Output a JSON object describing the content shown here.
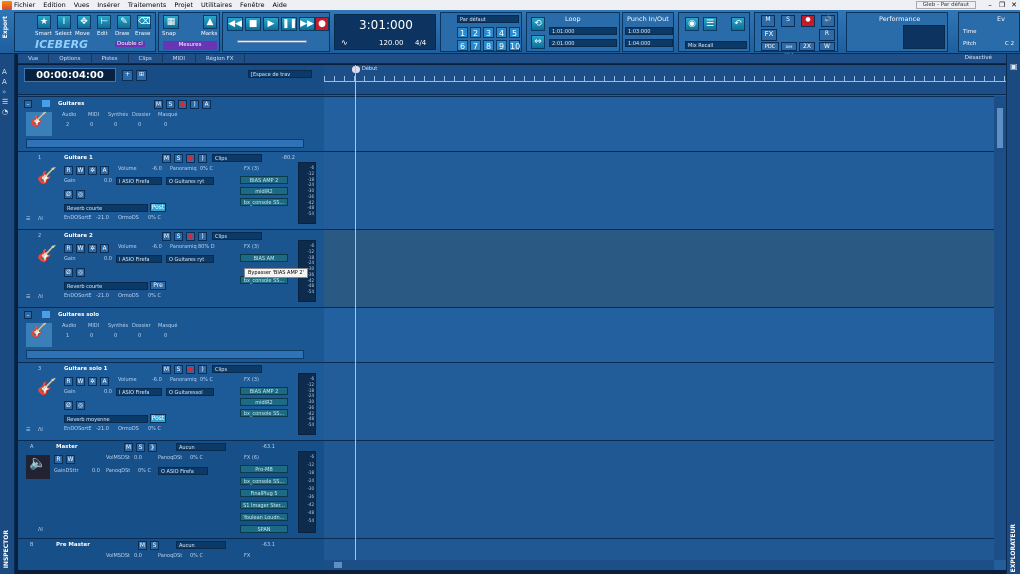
{
  "menubar": {
    "items": [
      "Fichier",
      "Edition",
      "Vues",
      "Insérer",
      "Traitements",
      "Projet",
      "Utilitaires",
      "Fenêtre",
      "Aide"
    ],
    "workspace": "Gleb - Par défaut"
  },
  "controlbar": {
    "export_label": "Export",
    "tools": [
      {
        "label": "Smart"
      },
      {
        "label": "Select"
      },
      {
        "label": "Move"
      },
      {
        "label": "Edit"
      },
      {
        "label": "Draw"
      },
      {
        "label": "Erase"
      }
    ],
    "tool_mode": "Double cl",
    "logo": "ICEBERG",
    "snap_label": "Snap",
    "marks_label": "Marks",
    "measures_label": "Mesures",
    "time_display": "3:01:000",
    "tempo": "120.00",
    "meter": "4/4",
    "preset": "Par défaut",
    "numbers_top": [
      "1",
      "2",
      "3",
      "4",
      "5"
    ],
    "numbers_bottom": [
      "6",
      "7",
      "8",
      "9",
      "10"
    ],
    "loop_label": "Loop",
    "loop_start": "1:01:000",
    "loop_end": "2:01:000",
    "punch_label": "Punch In/Out",
    "punch_start": "1:03:000",
    "punch_end": "1:04:000",
    "mix_recall": "Mix Recall",
    "mix_buttons": [
      "M",
      "S",
      "R"
    ],
    "fx_label": "FX",
    "pdc_label": "PDC",
    "dim_solo": "DIM SOLO",
    "speed": "2X",
    "w_label": "W",
    "performance_label": "Performance",
    "ev_label": "Ev",
    "time_label": "Time",
    "pitch_label": "Pitch",
    "pitch_value": "C 2"
  },
  "tabs": [
    "Vue",
    "Options",
    "Pistes",
    "Clips",
    "MIDI",
    "Région FX"
  ],
  "track_header": {
    "time": "00:00:04:00",
    "workspace_dropdown": "[Espace de trav",
    "desactive": "Désactivé"
  },
  "side": {
    "left": "INSPECTOR",
    "right": "EXPLORATEUR"
  },
  "folders": [
    {
      "name": "Guitares",
      "cols": [
        "Audio",
        "MIDI",
        "Synthés",
        "Dossier",
        "Masqué"
      ],
      "counts": [
        "2",
        "0",
        "0",
        "0",
        "0"
      ]
    },
    {
      "name": "Guitares solo",
      "cols": [
        "Audio",
        "MIDI",
        "Synthés",
        "Dossier",
        "Masqué"
      ],
      "counts": [
        "1",
        "0",
        "0",
        "0",
        "0"
      ]
    }
  ],
  "tracks": [
    {
      "num": "1",
      "name": "Guitare 1",
      "clips": "Clips",
      "db": "-80.2",
      "volume": "Volume",
      "vol_val": "-6.0",
      "pan": "Panoramiq",
      "pan_val": "0% C",
      "gain": "Gain",
      "gain_val": "0.0",
      "input": "I ASIO Firefa",
      "output": "O Guitares ryt",
      "send": "Reverb courte",
      "post": "Post",
      "send_lvl": "EnDOSortE",
      "send_val": "-21.0",
      "send_pan": "OrmoDS",
      "send_pan_val": "0% C",
      "fx_count": "FX (3)",
      "fx": [
        "BIAS AMP 2",
        "midiR2",
        "bx_console SS..."
      ]
    },
    {
      "num": "2",
      "name": "Guitare 2",
      "clips": "Clips",
      "db": "",
      "volume": "Volume",
      "vol_val": "-6.0",
      "pan": "Panoramiq",
      "pan_val": "80% D",
      "gain": "Gain",
      "gain_val": "0.0",
      "input": "I ASIO Firefa",
      "output": "O Guitares ryt",
      "send": "Reverb courte",
      "post": "Pre",
      "send_lvl": "EnDOSortE",
      "send_val": "-21.0",
      "send_pan": "OrmoDS",
      "send_pan_val": "0% C",
      "fx_count": "FX (3)",
      "fx": [
        "BIAS AM",
        "",
        "bx_console SS..."
      ]
    },
    {
      "num": "3",
      "name": "Guitare solo 1",
      "clips": "Clips",
      "db": "",
      "volume": "Volume",
      "vol_val": "-6.0",
      "pan": "Panoramiq",
      "pan_val": "0% C",
      "gain": "Gain",
      "gain_val": "0.0",
      "input": "I ASIO Firefa",
      "output": "O Guitaressol",
      "send": "Reverb moyenne",
      "post": "Post",
      "send_lvl": "EnDOSortE",
      "send_val": "-21.0",
      "send_pan": "OrmoDS",
      "send_pan_val": "0% C",
      "fx_count": "FX (3)",
      "fx": [
        "BIAS AMP 2",
        "midiR2",
        "bx_console SS..."
      ]
    }
  ],
  "master": {
    "label": "A",
    "name": "Master",
    "route": "Aucun",
    "db": "-63.1",
    "vol": "VolMSDSt",
    "vol_val": "0.0",
    "pan": "PanoqDSt",
    "pan_val": "0% C",
    "gain": "GainDSttr",
    "gain_val": "0.0",
    "pan2": "PanoqDSt",
    "pan2_val": "0% C",
    "input": "O ASIO Firefa",
    "fx_count": "FX (6)",
    "fx": [
      "Pro-MB",
      "bx_console SS...",
      "FinalPlug 5",
      "S1 Imager Ster...",
      "Youlean Loudn...",
      "SPAN"
    ]
  },
  "premaster": {
    "num": "B",
    "name": "Pre Master",
    "route": "Aucun",
    "db": "-63.1",
    "vol": "VolMSDSt",
    "vol_val": "0.0",
    "pan": "PanoqDSt",
    "pan_val": "0% C",
    "fx_count": "FX"
  },
  "tooltip": "Bypasser 'BIAS AMP 2'",
  "ruler_label": "Début",
  "meter_ticks": [
    "-6",
    "-12",
    "-18",
    "-24",
    "-30",
    "-36",
    "-42",
    "-48",
    "-54"
  ]
}
